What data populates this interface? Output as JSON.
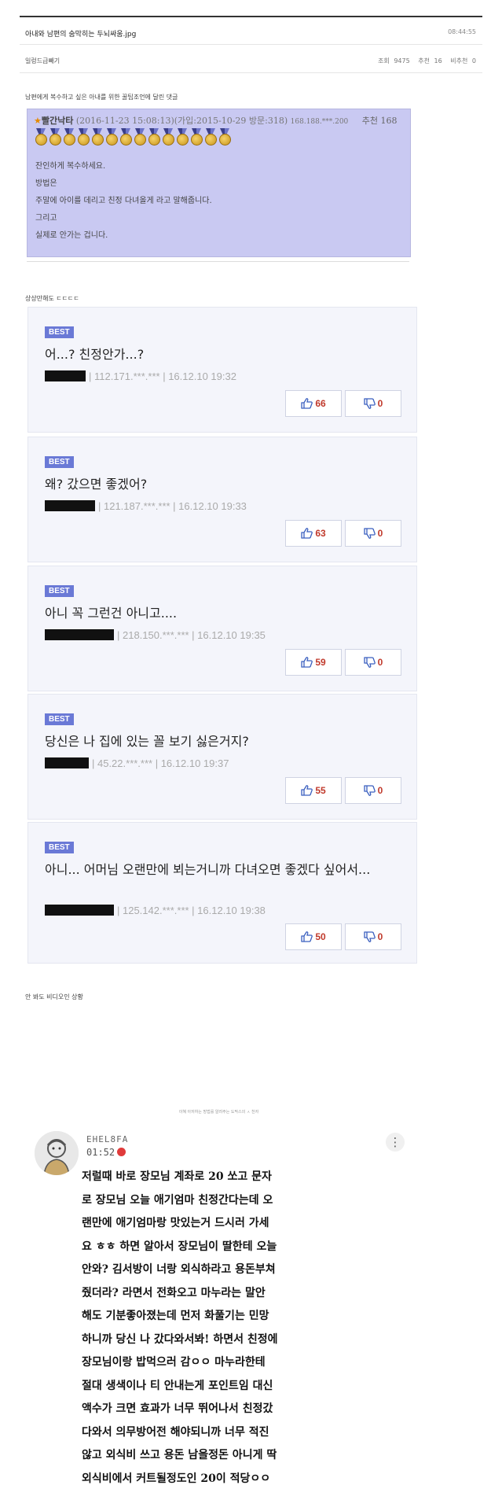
{
  "post": {
    "title": "아내와 남편의 숨막히는 두뇌싸움.jpg",
    "time": "08:44:55",
    "category": "일렁드급빼기",
    "views_label": "조회",
    "views": "9475",
    "rec_label": "추천",
    "rec": "16",
    "nonrec_label": "비추천",
    "nonrec": "0"
  },
  "captions": {
    "first": "남편에게 복수하고 싶은 아내를 위한 꿀팁조언에 달린 댓글",
    "second": "상상만해도 ㄷㄷㄷㄷ",
    "third": "안 봐도 비디오인 상황"
  },
  "purple_comment": {
    "star": "★",
    "nick": "빨간낙타",
    "date": "(2016-11-23 15:08:13)",
    "joined": "(가입:2015-10-29 방문:318)",
    "ip": "168.188.***.200",
    "rec": "추천 168",
    "lines": [
      "잔인하게 복수하세요.",
      "방법은",
      "주말에 아이를 데리고 친정 다녀올게 라고 말해줍니다.",
      "그리고",
      "실제로 안가는 겁니다."
    ]
  },
  "best_comments": [
    {
      "badge": "BEST",
      "text": "어...? 친정안가...?",
      "meta": "| 112.171.***.*** | 16.12.10 19:32",
      "up": "66",
      "down": "0"
    },
    {
      "badge": "BEST",
      "text": "왜? 갔으면 좋겠어?",
      "meta": "| 121.187.***.*** | 16.12.10 19:33",
      "up": "63",
      "down": "0"
    },
    {
      "badge": "BEST",
      "text": "아니 꼭 그런건 아니고....",
      "meta": "| 218.150.***.*** | 16.12.10 19:35",
      "up": "59",
      "down": "0"
    },
    {
      "badge": "BEST",
      "text": "당신은 나 집에 있는 꼴 보기 싫은거지?",
      "meta": "| 45.22.***.*** | 16.12.10 19:37",
      "up": "55",
      "down": "0"
    },
    {
      "badge": "BEST",
      "text": "아니... 어머님 오랜만에 뵈는거니까 다녀오면 좋겠다 싶어서...",
      "meta": "| 125.142.***.*** | 16.12.10 19:38",
      "up": "50",
      "down": "0"
    }
  ],
  "hand_comment": {
    "top": "이혜 아저하는 방법를 알려주는 도막스의 ㅅ 천자",
    "user": "EHEL8FA",
    "time": "01:52",
    "lines": [
      "저럴때 바로 장모님 계좌로 20 쏘고 문자",
      "로 장모님 오늘 애기엄마 친정간다는데 오",
      "랜만에 애기엄마랑 맛있는거 드시러 가세",
      "요 ㅎㅎ 하면 알아서 장모님이 딸한테 오늘",
      "안와? 김서방이 너랑 외식하라고 용돈부쳐",
      "줬더라? 라면서 전화오고 마누라는 말안",
      "해도 기분좋아졌는데 먼저 화풀기는 민망",
      "하니까 당신 나 갔다와서봐! 하면서 친정에",
      "장모님이랑 밥먹으러 감ㅇㅇ 마누라한테",
      "절대 생색이나 티 안내는게 포인트임 대신",
      "액수가 크면 효과가 너무 뛰어나서 친정갔",
      "다와서 의무방어전 해야되니까 너무 적진",
      "않고 외식비 쓰고 용돈 남을정돈 아니게 딱",
      "외식비에서 커트될정도인 20이 적당ㅇㅇ"
    ]
  }
}
